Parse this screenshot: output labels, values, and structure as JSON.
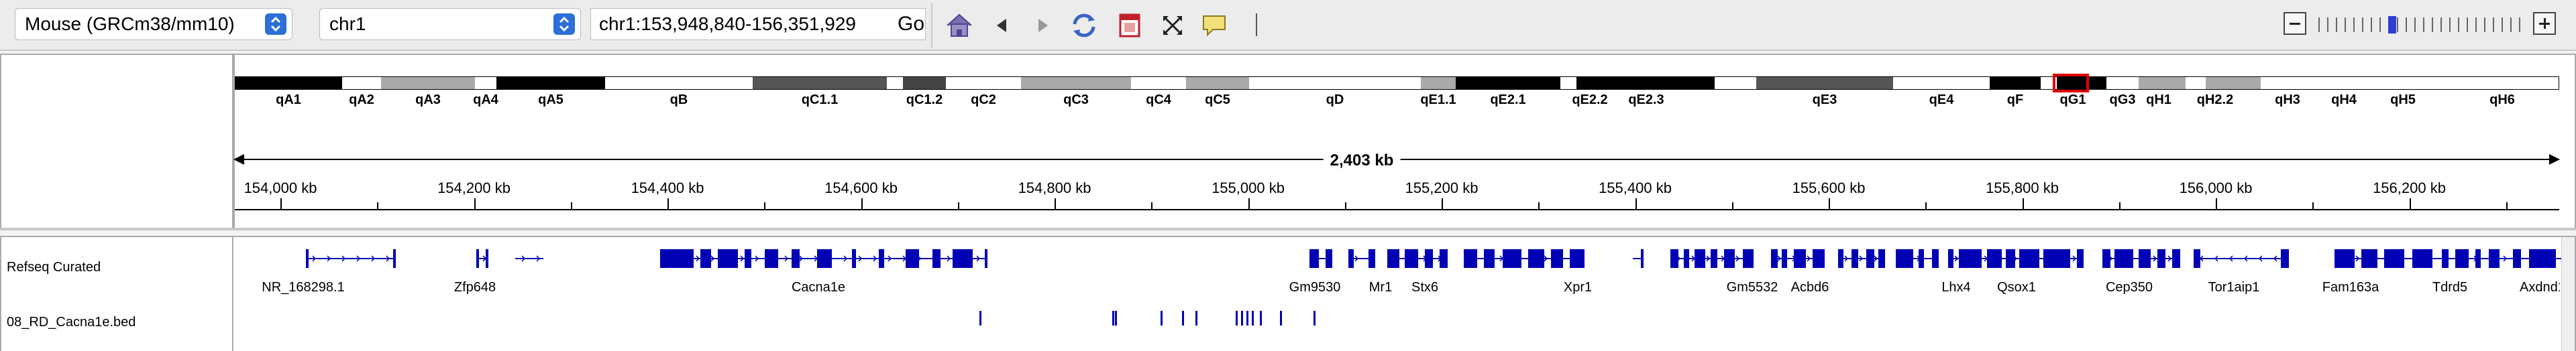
{
  "toolbar": {
    "genome": "Mouse (GRCm38/mm10)",
    "chromosome": "chr1",
    "locus": "chr1:153,948,840-156,351,929",
    "go_label": "Go",
    "zoom_minus": "−",
    "zoom_plus": "+",
    "icons": [
      "home-icon",
      "back-arrow-icon",
      "forward-arrow-icon",
      "refresh-icon",
      "region-of-interest-icon",
      "fit-to-window-icon",
      "popup-text-icon"
    ]
  },
  "ideogram": {
    "bands": [
      "qA1",
      "qA2",
      "qA3",
      "qA4",
      "qA5",
      "qB",
      "qC1.1",
      "qC1.2",
      "qC2",
      "qC3",
      "qC4",
      "qC5",
      "qD",
      "qE1.1",
      "qE2.1",
      "qE2.2",
      "qE2.3",
      "qE3",
      "qE4",
      "qF",
      "qG1",
      "qG3",
      "qH1",
      "qH2.2",
      "qH3",
      "qH4",
      "qH5",
      "qH6"
    ]
  },
  "ruler": {
    "span": "2,403 kb",
    "ticks": [
      "154,000 kb",
      "154,200 kb",
      "154,400 kb",
      "154,600 kb",
      "154,800 kb",
      "155,000 kb",
      "155,200 kb",
      "155,400 kb",
      "155,600 kb",
      "155,800 kb",
      "156,000 kb",
      "156,200 kb"
    ]
  },
  "tracks": {
    "refseq": {
      "name": "Refseq Curated",
      "genes": [
        "NR_168298.1",
        "Zfp648",
        "Cacna1e",
        "Gm9530",
        "Mr1",
        "Stx6",
        "Xpr1",
        "Gm5532",
        "Acbd6",
        "Lhx4",
        "Qsox1",
        "Cep350",
        "Tor1aip1",
        "Fam163a",
        "Tdrd5",
        "Axdnd1"
      ]
    },
    "bed": {
      "name": "08_RD_Cacna1e.bed"
    }
  },
  "colors": {
    "feature": "#0000b4",
    "ideogram_highlight": "#e00000",
    "accent": "#2c6fd6"
  }
}
